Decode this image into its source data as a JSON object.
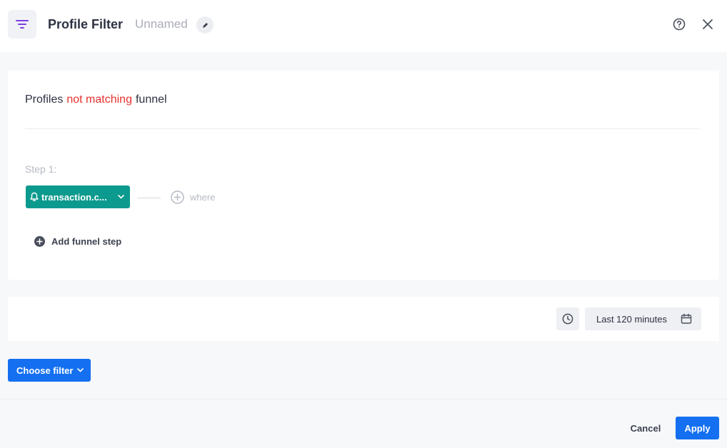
{
  "header": {
    "title": "Profile Filter",
    "name": "Unnamed",
    "filter_icon": "filter-lines-icon",
    "edit_icon": "pencil-icon",
    "help_icon": "help-circle-icon",
    "close_icon": "close-icon"
  },
  "card": {
    "prefix": "Profiles",
    "negation": "not matching",
    "suffix": "funnel",
    "step_label": "Step 1:",
    "event_label": "transaction.c...",
    "event_icon": "bell-icon",
    "where_label": "where",
    "add_step_label": "Add funnel step"
  },
  "time": {
    "range_label": "Last 120 minutes",
    "clock_icon": "clock-icon",
    "calendar_icon": "calendar-icon"
  },
  "filter": {
    "choose_label": "Choose filter"
  },
  "footer": {
    "cancel_label": "Cancel",
    "apply_label": "Apply"
  },
  "colors": {
    "accent": "#1470f0",
    "teal": "#0d9a8e",
    "negation": "#e5322d",
    "filter_icon": "#7b3fe4"
  }
}
